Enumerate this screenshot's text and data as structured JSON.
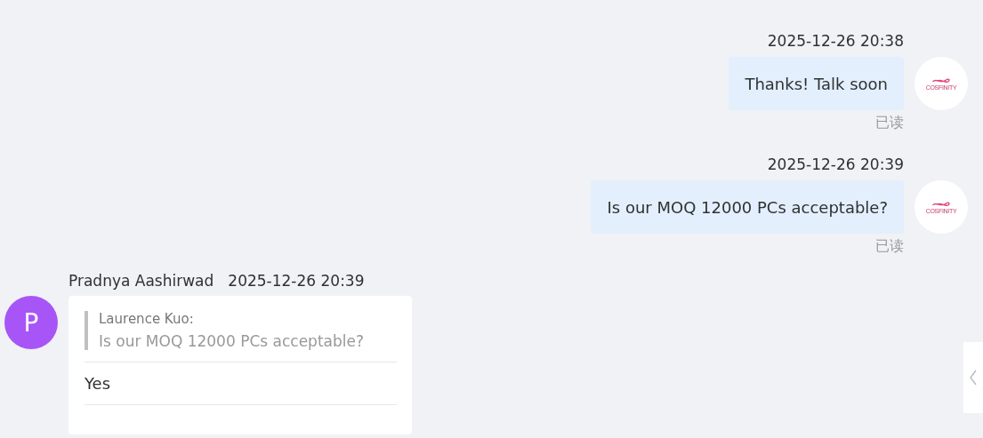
{
  "messages": [
    {
      "kind": "outgoing",
      "time": "2025-12-26 20:38",
      "text": "Thanks! Talk soon",
      "status": "已读",
      "avatar_logo": "COSFINITY"
    },
    {
      "kind": "outgoing",
      "time": "2025-12-26 20:39",
      "text": "Is our MOQ 12000 PCs acceptable?",
      "status": "已读",
      "avatar_logo": "COSFINITY"
    },
    {
      "kind": "incoming",
      "sender": "Pradnya Aashirwad",
      "time": "2025-12-26 20:39",
      "avatar_initial": "P",
      "quote": {
        "author": "Laurence Kuo:",
        "text": "Is our MOQ 12000 PCs acceptable?"
      },
      "text": "Yes"
    }
  ],
  "side_panel_toggle": {
    "expanded": false
  }
}
